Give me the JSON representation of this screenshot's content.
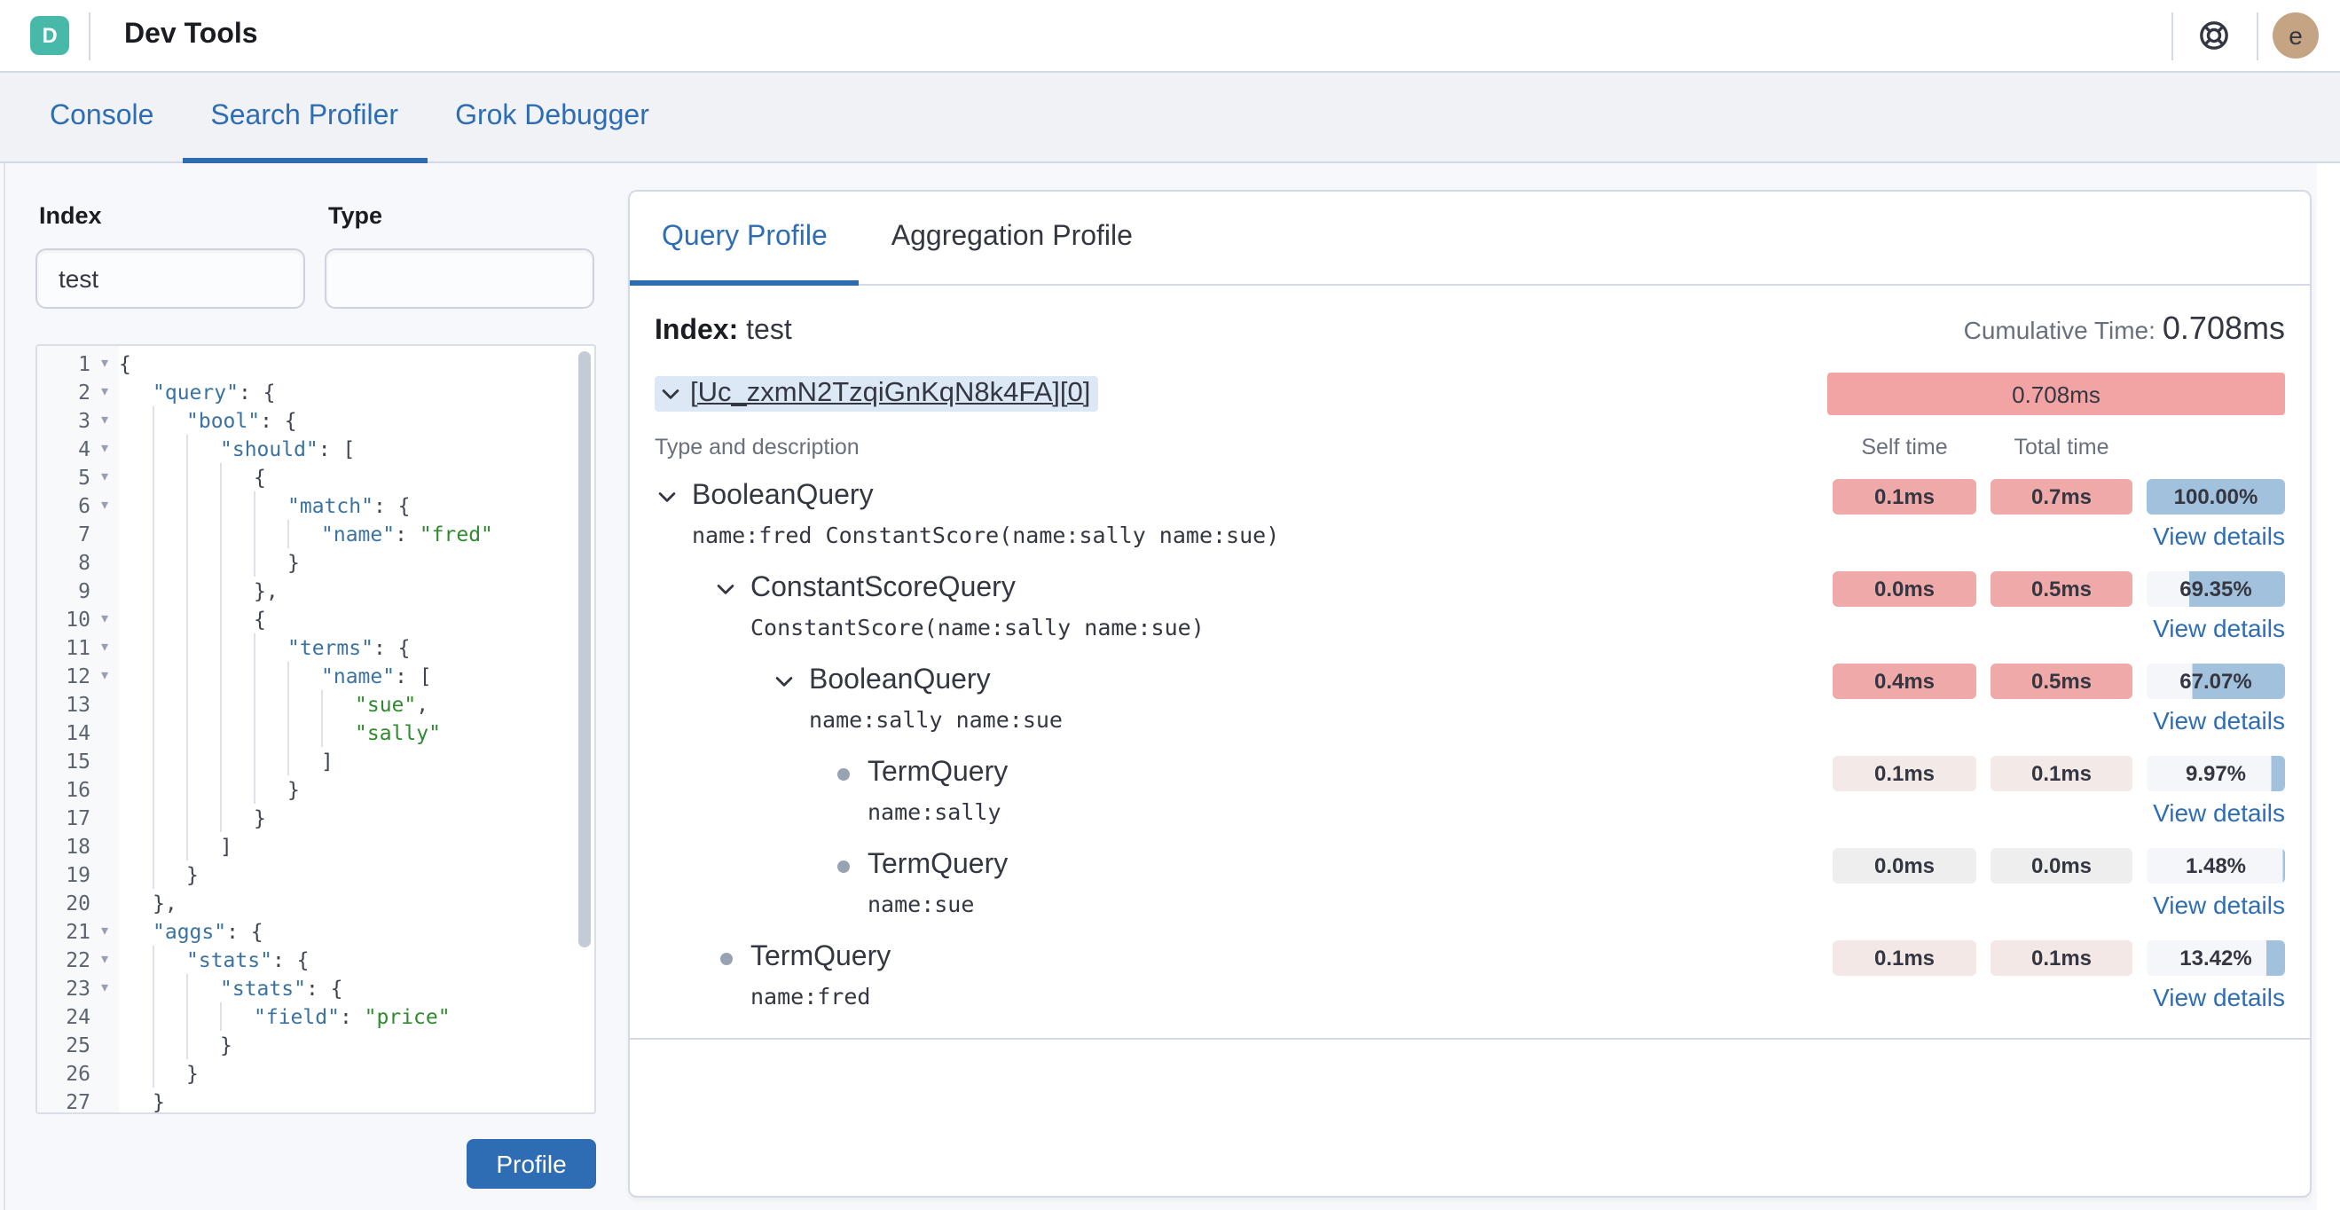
{
  "header": {
    "logo_letter": "D",
    "title": "Dev Tools",
    "avatar_initial": "e"
  },
  "nav": {
    "tabs": [
      {
        "label": "Console",
        "active": false
      },
      {
        "label": "Search Profiler",
        "active": true
      },
      {
        "label": "Grok Debugger",
        "active": false
      }
    ]
  },
  "request_form": {
    "index_label": "Index",
    "index_value": "test",
    "type_label": "Type",
    "type_value": ""
  },
  "editor": {
    "lines": [
      {
        "n": 1,
        "fold": true,
        "ind": 0,
        "tk": [
          [
            "p",
            "{"
          ]
        ]
      },
      {
        "n": 2,
        "fold": true,
        "ind": 1,
        "tk": [
          [
            "k",
            "\"query\""
          ],
          [
            "p",
            ": {"
          ]
        ]
      },
      {
        "n": 3,
        "fold": true,
        "ind": 2,
        "tk": [
          [
            "k",
            "\"bool\""
          ],
          [
            "p",
            ": {"
          ]
        ]
      },
      {
        "n": 4,
        "fold": true,
        "ind": 3,
        "tk": [
          [
            "k",
            "\"should\""
          ],
          [
            "p",
            ": ["
          ]
        ]
      },
      {
        "n": 5,
        "fold": true,
        "ind": 4,
        "tk": [
          [
            "p",
            "{"
          ]
        ]
      },
      {
        "n": 6,
        "fold": true,
        "ind": 5,
        "tk": [
          [
            "k",
            "\"match\""
          ],
          [
            "p",
            ": {"
          ]
        ]
      },
      {
        "n": 7,
        "fold": false,
        "ind": 6,
        "tk": [
          [
            "k",
            "\"name\""
          ],
          [
            "p",
            ": "
          ],
          [
            "s",
            "\"fred\""
          ]
        ]
      },
      {
        "n": 8,
        "fold": false,
        "ind": 5,
        "tk": [
          [
            "p",
            "}"
          ]
        ]
      },
      {
        "n": 9,
        "fold": false,
        "ind": 4,
        "tk": [
          [
            "p",
            "},"
          ]
        ]
      },
      {
        "n": 10,
        "fold": true,
        "ind": 4,
        "tk": [
          [
            "p",
            "{"
          ]
        ]
      },
      {
        "n": 11,
        "fold": true,
        "ind": 5,
        "tk": [
          [
            "k",
            "\"terms\""
          ],
          [
            "p",
            ": {"
          ]
        ]
      },
      {
        "n": 12,
        "fold": true,
        "ind": 6,
        "tk": [
          [
            "k",
            "\"name\""
          ],
          [
            "p",
            ": ["
          ]
        ]
      },
      {
        "n": 13,
        "fold": false,
        "ind": 7,
        "tk": [
          [
            "s",
            "\"sue\""
          ],
          [
            "p",
            ","
          ]
        ]
      },
      {
        "n": 14,
        "fold": false,
        "ind": 7,
        "tk": [
          [
            "s",
            "\"sally\""
          ]
        ]
      },
      {
        "n": 15,
        "fold": false,
        "ind": 6,
        "tk": [
          [
            "p",
            "]"
          ]
        ]
      },
      {
        "n": 16,
        "fold": false,
        "ind": 5,
        "tk": [
          [
            "p",
            "}"
          ]
        ]
      },
      {
        "n": 17,
        "fold": false,
        "ind": 4,
        "tk": [
          [
            "p",
            "}"
          ]
        ]
      },
      {
        "n": 18,
        "fold": false,
        "ind": 3,
        "tk": [
          [
            "p",
            "]"
          ]
        ]
      },
      {
        "n": 19,
        "fold": false,
        "ind": 2,
        "tk": [
          [
            "p",
            "}"
          ]
        ]
      },
      {
        "n": 20,
        "fold": false,
        "ind": 1,
        "tk": [
          [
            "p",
            "},"
          ]
        ]
      },
      {
        "n": 21,
        "fold": true,
        "ind": 1,
        "tk": [
          [
            "k",
            "\"aggs\""
          ],
          [
            "p",
            ": {"
          ]
        ]
      },
      {
        "n": 22,
        "fold": true,
        "ind": 2,
        "tk": [
          [
            "k",
            "\"stats\""
          ],
          [
            "p",
            ": {"
          ]
        ]
      },
      {
        "n": 23,
        "fold": true,
        "ind": 3,
        "tk": [
          [
            "k",
            "\"stats\""
          ],
          [
            "p",
            ": {"
          ]
        ]
      },
      {
        "n": 24,
        "fold": false,
        "ind": 4,
        "tk": [
          [
            "k",
            "\"field\""
          ],
          [
            "p",
            ": "
          ],
          [
            "s",
            "\"price\""
          ]
        ]
      },
      {
        "n": 25,
        "fold": false,
        "ind": 3,
        "tk": [
          [
            "p",
            "}"
          ]
        ]
      },
      {
        "n": 26,
        "fold": false,
        "ind": 2,
        "tk": [
          [
            "p",
            "}"
          ]
        ]
      },
      {
        "n": 27,
        "fold": false,
        "ind": 1,
        "tk": [
          [
            "p",
            "}"
          ]
        ]
      }
    ]
  },
  "profile_button_label": "Profile",
  "profiler": {
    "tabs": [
      {
        "label": "Query Profile",
        "active": true
      },
      {
        "label": "Aggregation Profile",
        "active": false
      }
    ],
    "index_label": "Index:",
    "index_value": "test",
    "cumulative_label": "Cumulative Time:",
    "cumulative_value": "0.708ms",
    "shard": {
      "id": "[Uc_zxmN2TzqiGnKqN8k4FA][0]",
      "time": "0.708ms",
      "bar_color": "#f2a4a4"
    },
    "columns": {
      "type": "Type and description",
      "self": "Self time",
      "total": "Total time"
    },
    "view_details_label": "View details",
    "rows": [
      {
        "name": "BooleanQuery",
        "desc": "name:fred ConstantScore(name:sally name:sue)",
        "depth": 0,
        "marker": "chevron",
        "self": "0.1ms",
        "total": "0.7ms",
        "heat": "#f0a9a9",
        "pct": 100,
        "pct_label": "100.00%"
      },
      {
        "name": "ConstantScoreQuery",
        "desc": "ConstantScore(name:sally name:sue)",
        "depth": 1,
        "marker": "chevron",
        "self": "0.0ms",
        "total": "0.5ms",
        "heat": "#f0a9a9",
        "pct": 69.35,
        "pct_label": "69.35%"
      },
      {
        "name": "BooleanQuery",
        "desc": "name:sally name:sue",
        "depth": 2,
        "marker": "chevron",
        "self": "0.4ms",
        "total": "0.5ms",
        "heat": "#f0a9a9",
        "pct": 67.07,
        "pct_label": "67.07%"
      },
      {
        "name": "TermQuery",
        "desc": "name:sally",
        "depth": 3,
        "marker": "bullet",
        "self": "0.1ms",
        "total": "0.1ms",
        "heat": "#f3e9e7",
        "pct": 9.97,
        "pct_label": "9.97%"
      },
      {
        "name": "TermQuery",
        "desc": "name:sue",
        "depth": 3,
        "marker": "bullet",
        "self": "0.0ms",
        "total": "0.0ms",
        "heat": "#efeeee",
        "pct": 1.48,
        "pct_label": "1.48%"
      },
      {
        "name": "TermQuery",
        "desc": "name:fred",
        "depth": 1,
        "marker": "bullet",
        "self": "0.1ms",
        "total": "0.1ms",
        "heat": "#f3e8e5",
        "pct": 13.42,
        "pct_label": "13.42%"
      }
    ]
  },
  "colors": {
    "accent_blue": "#2e6cb2",
    "link_blue": "#2f6db3",
    "logo_teal": "#48b8a8",
    "avatar_tan": "#c4a482",
    "heat_strong": "#f0a9a9",
    "pct_fill_blue": "#a2c1dd",
    "pct_track": "#f4f6fa",
    "shard_bar": "#f2a4a4"
  }
}
